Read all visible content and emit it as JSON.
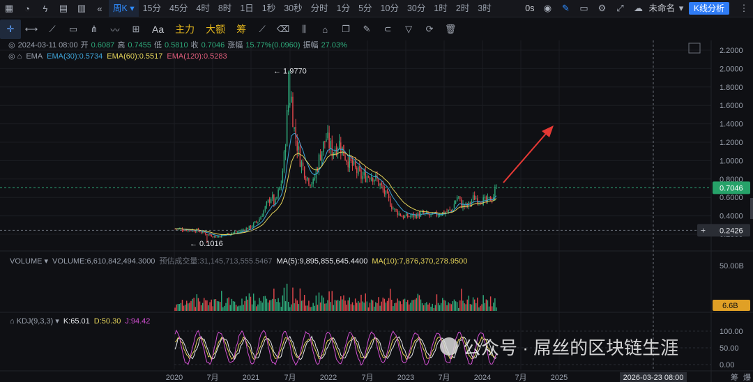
{
  "toolbar_top": {
    "active_timeframe": "周K",
    "timeframes": [
      "15分",
      "45分",
      "4时",
      "8时",
      "1日",
      "1秒",
      "30秒",
      "分时",
      "1分",
      "5分",
      "10分",
      "30分",
      "1时",
      "2时",
      "3时"
    ],
    "countdown": "0s",
    "workspace": "未命名",
    "analysis_button": "K线分析",
    "icons": [
      "chart-type-icon",
      "clock-icon",
      "lightning-icon",
      "calendar-icon",
      "layout-icon",
      "replay-icon"
    ]
  },
  "toolbar_draw": {
    "tools": [
      "crosshair-icon",
      "horizontal-line-icon",
      "trend-line-icon",
      "rectangle-icon",
      "fork-icon",
      "wave-icon",
      "measure-icon"
    ],
    "text_tool": "Aa",
    "orange_tools": [
      "主力",
      "大额",
      "筹"
    ],
    "more_tools": [
      "ruler-icon",
      "eraser-icon",
      "candle-icon",
      "lock-icon",
      "copy-icon",
      "note-icon",
      "magnet-icon",
      "filter-icon",
      "sync-icon",
      "trash-icon"
    ]
  },
  "info": {
    "date": "2024-03-11 08:00",
    "open_label": "开",
    "open": "0.6087",
    "high_label": "高",
    "high": "0.7455",
    "low_label": "低",
    "low": "0.5810",
    "close_label": "收",
    "close": "0.7046",
    "change_label": "涨幅",
    "change": "15.77%(0.0960)",
    "amp_label": "振幅",
    "amp": "27.03%"
  },
  "ema": {
    "label": "EMA",
    "ema30": "EMA(30):0.5734",
    "ema60": "EMA(60):0.5517",
    "ema120": "EMA(120):0.5283",
    "colors": {
      "ema30": "#3fa4d8",
      "ema60": "#e4d35a",
      "ema120": "#e05d7b"
    }
  },
  "volume": {
    "label": "VOLUME",
    "value": "VOLUME:6,610,842,494.3000",
    "est": "预估成交量:31,145,713,555.5467",
    "ma5": "MA(5):9,895,855,645.4400",
    "ma10": "MA(10):7,876,370,278.9500",
    "axis_top": "50.00B",
    "current": "6.6B"
  },
  "kdj": {
    "label": "KDJ(9,3,3)",
    "k": "K:65.01",
    "d": "D:50.30",
    "j": "J:94.42",
    "axis": [
      "100.00",
      "50.00",
      "0.00"
    ]
  },
  "price_axis": {
    "ticks": [
      "2.2000",
      "2.0000",
      "1.8000",
      "1.6000",
      "1.4000",
      "1.2000",
      "1.0000",
      "0.8000",
      "0.6000",
      "0.4000",
      "0.2000"
    ],
    "current_price": "0.7046",
    "crosshair_price": "0.2426"
  },
  "time_axis": {
    "ticks": [
      "2020",
      "7月",
      "2021",
      "7月",
      "2022",
      "7月",
      "2023",
      "7月",
      "2024",
      "7月",
      "2025"
    ],
    "crosshair_date": "2026-03-23 08:00",
    "right_labels": [
      "筹",
      "爆"
    ]
  },
  "annotations": {
    "high_label": "← 1.9770",
    "low_label": "← 0.1016"
  },
  "watermark": "公众号 · 屌丝的区块链生涯",
  "chart_data": {
    "type": "candlestick",
    "interval": "weekly",
    "ylim": [
      0.1,
      2.25
    ],
    "x": "2019-12 to 2024-03",
    "price_path": [
      [
        0.0,
        0.26
      ],
      [
        0.07,
        0.24
      ],
      [
        0.1,
        0.2
      ],
      [
        0.13,
        0.17
      ],
      [
        0.17,
        0.21
      ],
      [
        0.2,
        0.23
      ],
      [
        0.23,
        0.27
      ],
      [
        0.26,
        0.35
      ],
      [
        0.28,
        0.48
      ],
      [
        0.3,
        0.62
      ],
      [
        0.31,
        0.52
      ],
      [
        0.33,
        0.75
      ],
      [
        0.34,
        1.05
      ],
      [
        0.35,
        1.55
      ],
      [
        0.36,
        1.75
      ],
      [
        0.37,
        1.35
      ],
      [
        0.39,
        1.0
      ],
      [
        0.41,
        0.82
      ],
      [
        0.43,
        0.75
      ],
      [
        0.45,
        1.05
      ],
      [
        0.47,
        1.25
      ],
      [
        0.49,
        1.1
      ],
      [
        0.51,
        1.2
      ],
      [
        0.53,
        1.05
      ],
      [
        0.55,
        0.95
      ],
      [
        0.58,
        0.82
      ],
      [
        0.61,
        0.85
      ],
      [
        0.63,
        0.78
      ],
      [
        0.66,
        0.6
      ],
      [
        0.68,
        0.47
      ],
      [
        0.71,
        0.39
      ],
      [
        0.74,
        0.4
      ],
      [
        0.77,
        0.42
      ],
      [
        0.8,
        0.4
      ],
      [
        0.83,
        0.43
      ],
      [
        0.86,
        0.46
      ],
      [
        0.88,
        0.62
      ],
      [
        0.89,
        0.52
      ],
      [
        0.91,
        0.5
      ],
      [
        0.93,
        0.6
      ],
      [
        0.95,
        0.58
      ],
      [
        0.97,
        0.55
      ],
      [
        0.99,
        0.61
      ],
      [
        1.0,
        0.7046
      ]
    ],
    "extremes": {
      "high": 1.977,
      "low": 0.1016
    },
    "current_price": 0.7046,
    "ema": {
      "ema30": 0.5734,
      "ema60": 0.5517,
      "ema120": 0.5283
    },
    "volume_ma5": 9895855645.44,
    "volume_ma10": 7876370278.95,
    "kdj": {
      "k": 65.01,
      "d": 50.3,
      "j": 94.42
    }
  }
}
